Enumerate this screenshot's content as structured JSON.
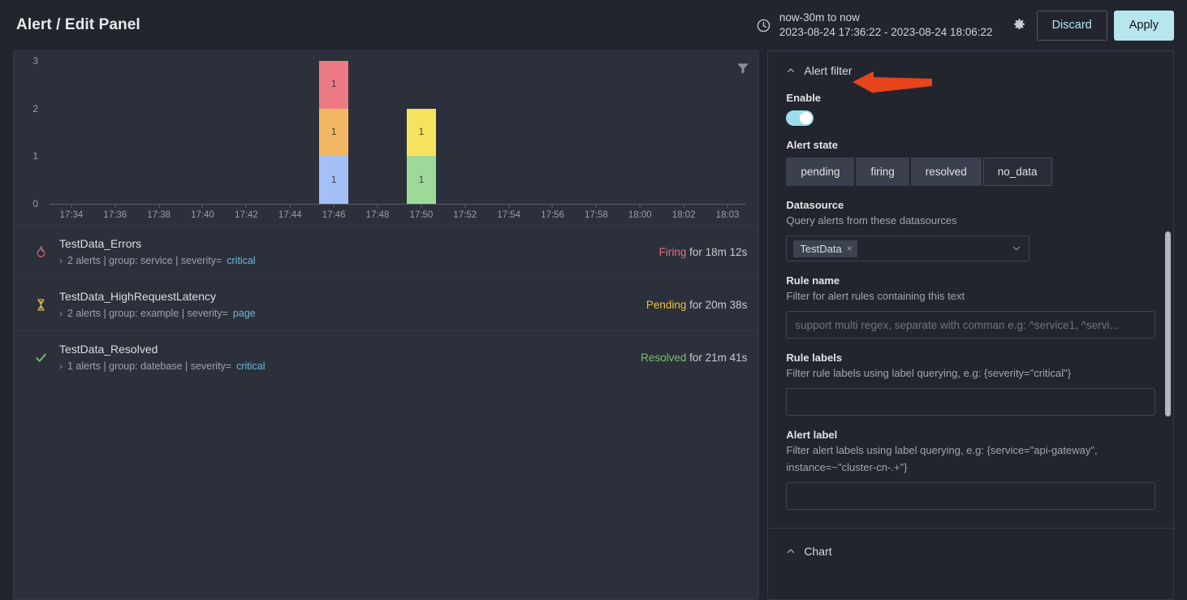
{
  "header": {
    "title": "Alert / Edit Panel",
    "clock_icon": "clock-icon",
    "time_relative": "now-30m to now",
    "time_absolute": "2023-08-24 17:36:22 - 2023-08-24 18:06:22",
    "gear_icon": "gear-icon",
    "discard_label": "Discard",
    "apply_label": "Apply",
    "apply_bg": "#B9E5F0",
    "discard_text_color": "#B3E8F5"
  },
  "chart_data": {
    "type": "bar",
    "stacked": true,
    "title": "",
    "xlabel": "",
    "ylabel": "",
    "ylim": [
      0,
      3
    ],
    "yticks": [
      "0",
      "1",
      "2",
      "3"
    ],
    "grid": false,
    "legend": "none",
    "categories": [
      "17:34",
      "17:36",
      "17:38",
      "17:40",
      "17:42",
      "17:44",
      "17:46",
      "17:48",
      "17:50",
      "17:52",
      "17:54",
      "17:56",
      "17:58",
      "18:00",
      "18:02",
      "18:03"
    ],
    "bars": [
      {
        "x": "17:46",
        "x_index": 6,
        "total": 3,
        "segments": [
          {
            "label": "1",
            "value": 1,
            "color": "#A4BFF5"
          },
          {
            "label": "1",
            "value": 1,
            "color": "#F2B762"
          },
          {
            "label": "1",
            "value": 1,
            "color": "#ED7B84"
          }
        ]
      },
      {
        "x": "17:50",
        "x_index": 8,
        "total": 2,
        "segments": [
          {
            "label": "1",
            "value": 1,
            "color": "#9ED99A"
          },
          {
            "label": "1",
            "value": 1,
            "color": "#F7E25E"
          }
        ]
      }
    ],
    "filter_icon": "filter-icon"
  },
  "alerts": [
    {
      "icon": "fire-icon",
      "icon_color": "#E4707A",
      "name": "TestData_Errors",
      "meta_prefix": "2 alerts | group: service | severity=",
      "meta_severity": "critical",
      "state": "Firing",
      "state_class": "st-firing",
      "duration": "for 18m 12s"
    },
    {
      "icon": "hourglass-icon",
      "icon_color": "#E8C33C",
      "name": "TestData_HighRequestLatency",
      "meta_prefix": "2 alerts | group: example | severity=",
      "meta_severity": "page",
      "state": "Pending",
      "state_class": "st-pending",
      "duration": "for 20m 38s"
    },
    {
      "icon": "check-icon",
      "icon_color": "#7BBF6A",
      "name": "TestData_Resolved",
      "meta_prefix": "1 alerts | group: datebase | severity=",
      "meta_severity": "critical",
      "state": "Resolved",
      "state_class": "st-resolved",
      "duration": "for 21m 41s"
    }
  ],
  "options": {
    "alert_filter": {
      "section_title": "Alert filter",
      "enable_label": "Enable",
      "enable_value": true,
      "alert_state_label": "Alert state",
      "alert_state_options": [
        "pending",
        "firing",
        "resolved",
        "no_data"
      ],
      "datasource_label": "Datasource",
      "datasource_desc": "Query alerts from these datasources",
      "datasource_chip": "TestData",
      "datasource_chip_remove": "×",
      "rule_name_label": "Rule name",
      "rule_name_desc": "Filter for alert rules containing this text",
      "rule_name_value": "",
      "rule_name_placeholder": "support multi regex, separate with comman e.g: ^service1, ^servi...",
      "rule_labels_label": "Rule labels",
      "rule_labels_desc": "Filter rule labels using label querying, e.g: {severity=\"critical\"}",
      "rule_labels_value": "",
      "rule_labels_placeholder": "",
      "alert_label_label": "Alert label",
      "alert_label_desc": "Filter alert labels using label querying, e.g: {service=\"api-gateway\", instance=~\"cluster-cn-.+\"}",
      "alert_label_value": "",
      "alert_label_placeholder": ""
    },
    "chart": {
      "section_title": "Chart"
    }
  },
  "annotation": {
    "arrow_color": "#E8441B",
    "arrow_points_to": "Alert filter"
  }
}
